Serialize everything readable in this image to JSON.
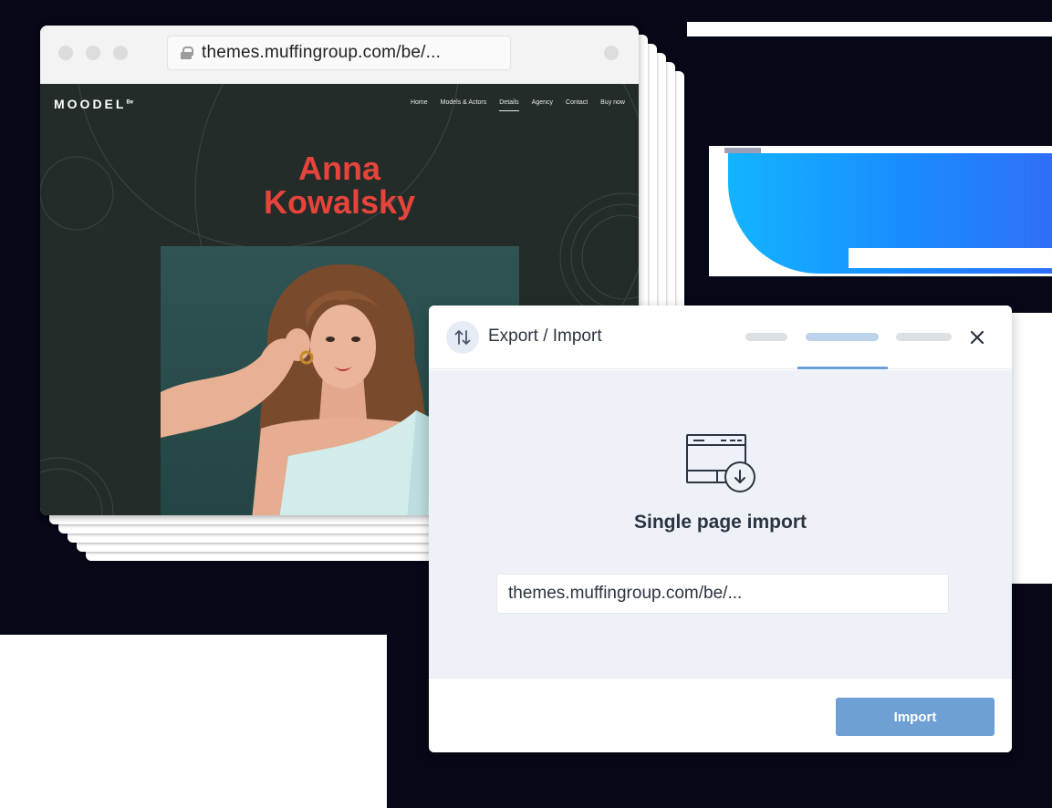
{
  "browser": {
    "url": "themes.muffingroup.com/be/..."
  },
  "site": {
    "logo": "MOODEL",
    "logo_mark": "Be",
    "nav": [
      "Home",
      "Models & Actors",
      "Details",
      "Agency",
      "Contact",
      "Buy now"
    ],
    "active_nav": "Details",
    "hero_first_name": "Anna",
    "hero_last_name": "Kowalsky"
  },
  "dialog": {
    "title": "Export / Import",
    "heading": "Single page import",
    "input_value": "themes.muffingroup.com/be/...",
    "import_button": "Import",
    "active_tab_index": 1
  },
  "colors": {
    "hero_name": "#e6443b",
    "site_background": "#232c28",
    "import_button": "#6ea0d4",
    "tab_underline": "#6aa0d6"
  }
}
